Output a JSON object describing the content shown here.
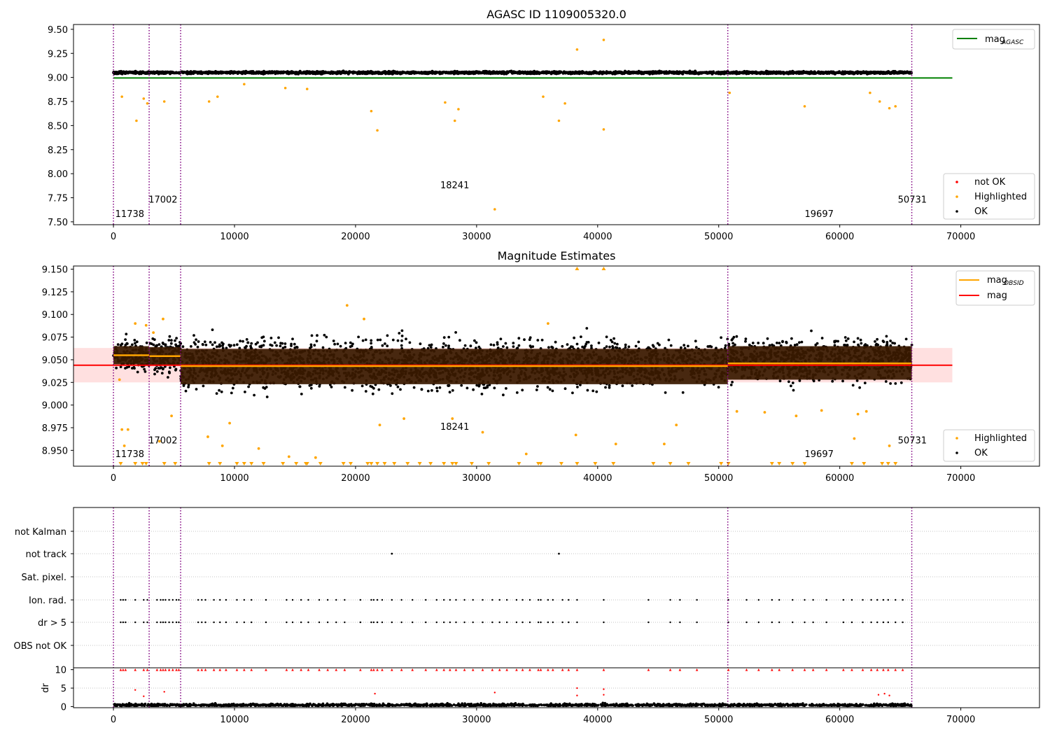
{
  "chart_data": [
    {
      "type": "scatter",
      "title": "AGASC ID 1109005320.0",
      "xlim": [
        -3300,
        76500
      ],
      "ylim": [
        7.47,
        9.55
      ],
      "x_ticks": [
        "0",
        "10000",
        "20000",
        "30000",
        "40000",
        "50000",
        "60000",
        "70000"
      ],
      "y_ticks": [
        "7.50",
        "7.75",
        "8.00",
        "8.25",
        "8.50",
        "8.75",
        "9.00",
        "9.25",
        "9.50"
      ],
      "obsid_boundaries": [
        0,
        2950,
        5550,
        50750,
        65950
      ],
      "obsid_labels": [
        {
          "text": "11738",
          "x": 150,
          "y": 7.55
        },
        {
          "text": "17002",
          "x": 2900,
          "y": 7.7
        },
        {
          "text": "18241",
          "x": 27000,
          "y": 7.85
        },
        {
          "text": "19697",
          "x": 57100,
          "y": 7.55
        },
        {
          "text": "50731",
          "x": 64800,
          "y": 7.7
        }
      ],
      "mag_agasc": {
        "value": 8.995,
        "x_range": [
          0,
          69300
        ],
        "color": "#008000"
      },
      "ok_band": {
        "center": 9.05,
        "half_width": 0.025,
        "color": "#000000"
      },
      "highlighted_points": [
        {
          "x": 700,
          "y": 8.8
        },
        {
          "x": 1900,
          "y": 8.55
        },
        {
          "x": 2500,
          "y": 8.78
        },
        {
          "x": 2800,
          "y": 8.73
        },
        {
          "x": 4200,
          "y": 8.75
        },
        {
          "x": 7900,
          "y": 8.75
        },
        {
          "x": 8600,
          "y": 8.8
        },
        {
          "x": 10800,
          "y": 8.93
        },
        {
          "x": 14200,
          "y": 8.89
        },
        {
          "x": 16000,
          "y": 8.88
        },
        {
          "x": 21300,
          "y": 8.65
        },
        {
          "x": 21800,
          "y": 8.45
        },
        {
          "x": 27400,
          "y": 8.74
        },
        {
          "x": 28200,
          "y": 8.55
        },
        {
          "x": 28500,
          "y": 8.67
        },
        {
          "x": 31500,
          "y": 7.63
        },
        {
          "x": 35500,
          "y": 8.8
        },
        {
          "x": 36800,
          "y": 8.55
        },
        {
          "x": 37300,
          "y": 8.73
        },
        {
          "x": 38300,
          "y": 9.29
        },
        {
          "x": 40500,
          "y": 9.39
        },
        {
          "x": 40500,
          "y": 8.46
        },
        {
          "x": 50900,
          "y": 8.84
        },
        {
          "x": 57100,
          "y": 8.7
        },
        {
          "x": 62500,
          "y": 8.84
        },
        {
          "x": 63300,
          "y": 8.75
        },
        {
          "x": 64100,
          "y": 8.68
        },
        {
          "x": 64600,
          "y": 8.7
        }
      ],
      "legend_upper": [
        {
          "label": "mag",
          "sub": "AGASC",
          "color": "#008000"
        }
      ],
      "legend_lower": [
        {
          "label": "not OK",
          "color": "#ff0000"
        },
        {
          "label": "Highlighted",
          "color": "#ffa500"
        },
        {
          "label": "OK",
          "color": "#000000"
        }
      ]
    },
    {
      "type": "scatter",
      "title": "Magnitude Estimates",
      "xlim": [
        -3300,
        76500
      ],
      "ylim": [
        8.9325,
        9.1535
      ],
      "x_ticks": [
        "0",
        "10000",
        "20000",
        "30000",
        "40000",
        "50000",
        "60000",
        "70000"
      ],
      "y_ticks": [
        "8.950",
        "8.975",
        "9.000",
        "9.025",
        "9.050",
        "9.075",
        "9.100",
        "9.125",
        "9.150"
      ],
      "obsid_boundaries": [
        0,
        2950,
        5550,
        50750,
        65950
      ],
      "obsid_labels": [
        {
          "text": "11738",
          "x": 150,
          "y": 8.9425
        },
        {
          "text": "17002",
          "x": 2900,
          "y": 8.9575
        },
        {
          "text": "18241",
          "x": 27000,
          "y": 8.9725
        },
        {
          "text": "19697",
          "x": 57100,
          "y": 8.9425
        },
        {
          "text": "50731",
          "x": 64800,
          "y": 8.9575
        }
      ],
      "mag": {
        "value": 9.044,
        "band": [
          9.025,
          9.063
        ],
        "x_range": [
          -3300,
          69300
        ],
        "color": "#ff0000",
        "band_color": "#ffe0e0"
      },
      "mag_obsid": [
        {
          "x": [
            0,
            2950
          ],
          "value": 9.055,
          "band": [
            9.045,
            9.065
          ]
        },
        {
          "x": [
            2950,
            5550
          ],
          "value": 9.054,
          "band": [
            9.044,
            9.064
          ]
        },
        {
          "x": [
            5550,
            50750
          ],
          "value": 9.043,
          "band": [
            9.023,
            9.062
          ]
        },
        {
          "x": [
            50750,
            65950
          ],
          "value": 9.046,
          "band": [
            9.028,
            9.065
          ]
        }
      ],
      "mag_obsid_color": "#ffa500",
      "scatter_ranges": [
        {
          "x": [
            0,
            2950
          ],
          "low": 9.025,
          "high": 9.085
        },
        {
          "x": [
            2950,
            5550
          ],
          "low": 9.02,
          "high": 9.09
        },
        {
          "x": [
            5550,
            50750
          ],
          "low": 8.995,
          "high": 9.095
        },
        {
          "x": [
            50750,
            65950
          ],
          "low": 9.005,
          "high": 9.095
        }
      ],
      "highlighted_points": [
        {
          "x": 500,
          "y": 9.028
        },
        {
          "x": 700,
          "y": 8.973
        },
        {
          "x": 900,
          "y": 8.955
        },
        {
          "x": 1200,
          "y": 8.973
        },
        {
          "x": 1800,
          "y": 9.09
        },
        {
          "x": 2700,
          "y": 9.088
        },
        {
          "x": 3300,
          "y": 9.08
        },
        {
          "x": 3800,
          "y": 8.96
        },
        {
          "x": 4100,
          "y": 9.095
        },
        {
          "x": 4800,
          "y": 8.988
        },
        {
          "x": 7800,
          "y": 8.965
        },
        {
          "x": 9000,
          "y": 8.955
        },
        {
          "x": 9600,
          "y": 8.98
        },
        {
          "x": 12000,
          "y": 8.952
        },
        {
          "x": 14500,
          "y": 8.943
        },
        {
          "x": 16700,
          "y": 8.942
        },
        {
          "x": 19300,
          "y": 9.11
        },
        {
          "x": 20700,
          "y": 9.095
        },
        {
          "x": 22000,
          "y": 8.978
        },
        {
          "x": 24000,
          "y": 8.985
        },
        {
          "x": 28000,
          "y": 8.985
        },
        {
          "x": 30500,
          "y": 8.97
        },
        {
          "x": 34100,
          "y": 8.946
        },
        {
          "x": 35900,
          "y": 9.09
        },
        {
          "x": 38200,
          "y": 8.967
        },
        {
          "x": 41500,
          "y": 8.957
        },
        {
          "x": 45500,
          "y": 8.957
        },
        {
          "x": 46500,
          "y": 8.978
        },
        {
          "x": 51500,
          "y": 8.993
        },
        {
          "x": 53800,
          "y": 8.992
        },
        {
          "x": 56400,
          "y": 8.988
        },
        {
          "x": 58500,
          "y": 8.994
        },
        {
          "x": 61200,
          "y": 8.963
        },
        {
          "x": 61500,
          "y": 8.99
        },
        {
          "x": 62200,
          "y": 8.993
        },
        {
          "x": 64100,
          "y": 8.955
        }
      ],
      "clipped_low_x": [
        600,
        1800,
        2400,
        2700,
        4200,
        5100,
        7900,
        8800,
        10200,
        10800,
        11400,
        12400,
        14000,
        15100,
        15900,
        16000,
        17100,
        19000,
        19600,
        21000,
        21300,
        21800,
        22400,
        23200,
        24300,
        25300,
        26200,
        27300,
        28000,
        28300,
        29600,
        31000,
        33500,
        35100,
        35300,
        37000,
        38300,
        39800,
        41300,
        44600,
        46000,
        47500,
        50200,
        50800,
        54400,
        55000,
        56100,
        57100,
        61000,
        62000,
        63500,
        64000,
        64600
      ],
      "clipped_high_x": [
        38300,
        40500
      ],
      "legend_upper": [
        {
          "label": "mag",
          "sub": "OBSID",
          "color": "#ffa500"
        },
        {
          "label": "mag",
          "sub": "",
          "color": "#ff0000"
        }
      ],
      "legend_lower": [
        {
          "label": "Highlighted",
          "color": "#ffa500"
        },
        {
          "label": "OK",
          "color": "#000000"
        }
      ]
    },
    {
      "type": "scatter",
      "xlim": [
        -3300,
        76500
      ],
      "x_ticks": [
        "0",
        "10000",
        "20000",
        "30000",
        "40000",
        "50000",
        "60000",
        "70000"
      ],
      "obsid_boundaries": [
        0,
        2950,
        5550,
        50750,
        65950
      ],
      "flag_rows": [
        "not Kalman",
        "not track",
        "Sat. pixel.",
        "Ion. rad.",
        "dr > 5",
        "OBS not OK"
      ],
      "not_track_x": [
        23000,
        36800
      ],
      "flag_x": [
        600,
        800,
        1000,
        1800,
        2500,
        2800,
        3600,
        3900,
        4100,
        4300,
        4600,
        4900,
        5200,
        5400,
        7000,
        7300,
        7600,
        8300,
        8800,
        9300,
        10200,
        10800,
        11400,
        12600,
        14300,
        14800,
        15500,
        16100,
        17000,
        17700,
        18400,
        19100,
        20400,
        21300,
        21500,
        21800,
        22200,
        23000,
        23800,
        24700,
        25800,
        26700,
        27300,
        27800,
        28300,
        29000,
        29700,
        30500,
        31300,
        31900,
        32500,
        33300,
        33800,
        34400,
        35100,
        35300,
        35900,
        36300,
        37100,
        37600,
        38300,
        40500,
        44200,
        46000,
        46800,
        48200,
        50800,
        52300,
        53300,
        54400,
        55000,
        56100,
        57100,
        57800,
        58900,
        60300,
        61000,
        61900,
        62600,
        63100,
        63600,
        64000,
        64600,
        65200
      ],
      "dr": {
        "ylim": [
          -0.3,
          10.5
        ],
        "y_ticks": [
          "0",
          "5",
          "10"
        ],
        "ylabel": "dr",
        "clip_value": 10,
        "threshold": 5
      },
      "dr_outliers": [
        {
          "x": 1800,
          "y": 4.5
        },
        {
          "x": 2500,
          "y": 2.8
        },
        {
          "x": 4200,
          "y": 4.0
        },
        {
          "x": 21600,
          "y": 3.5
        },
        {
          "x": 31500,
          "y": 3.8
        },
        {
          "x": 38300,
          "y": 5.0
        },
        {
          "x": 38300,
          "y": 3.0
        },
        {
          "x": 40500,
          "y": 4.7
        },
        {
          "x": 40500,
          "y": 3.2
        },
        {
          "x": 63200,
          "y": 3.2
        },
        {
          "x": 63700,
          "y": 3.5
        },
        {
          "x": 64100,
          "y": 3.0
        }
      ]
    }
  ]
}
